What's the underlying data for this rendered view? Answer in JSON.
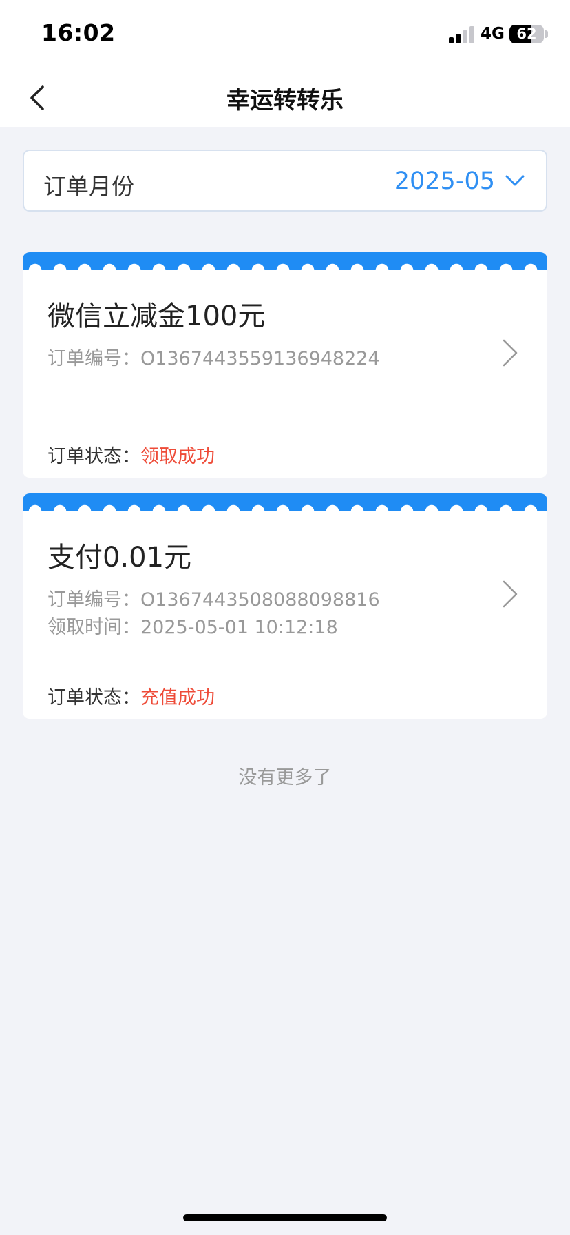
{
  "status_bar": {
    "time": "16:02",
    "network": "4G",
    "battery": "62",
    "battery_level_percent": 62,
    "icons": [
      "signal-icon",
      "battery-icon"
    ]
  },
  "nav": {
    "title": "幸运转转乐",
    "back_icon": "chevron-left-icon"
  },
  "month_selector": {
    "label": "订单月份",
    "value": "2025-05",
    "icon": "chevron-down-icon"
  },
  "orders": [
    {
      "title": "微信立减金100元",
      "order_no_label": "订单编号：",
      "order_no": "O1367443559136948224",
      "status_label": "订单状态：",
      "status": "领取成功"
    },
    {
      "title": "支付0.01元",
      "order_no_label": "订单编号：",
      "order_no": "O1367443508088098816",
      "time_label": "领取时间：",
      "time": "2025-05-01 10:12:18",
      "status_label": "订单状态：",
      "status": "充值成功"
    }
  ],
  "footer": {
    "no_more": "没有更多了"
  },
  "colors": {
    "accent": "#2f8ff3",
    "card_strip": "#1f8cf4",
    "status_success": "#ee4b38",
    "background": "#f2f3f8"
  }
}
